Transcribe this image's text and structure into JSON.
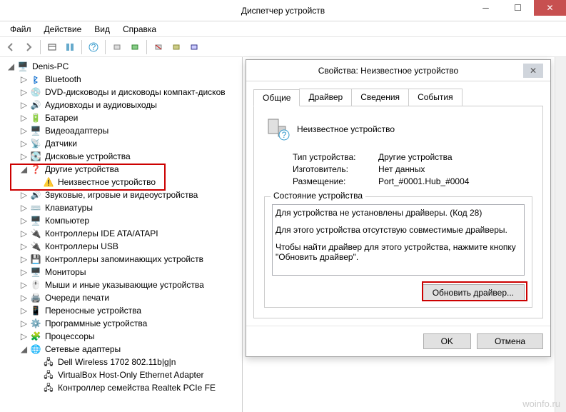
{
  "window": {
    "title": "Диспетчер устройств"
  },
  "menu": {
    "file": "Файл",
    "action": "Действие",
    "view": "Вид",
    "help": "Справка"
  },
  "tree": {
    "root": "Denis-PC",
    "bluetooth": "Bluetooth",
    "dvd": "DVD-дисководы и дисководы компакт-дисков",
    "audio": "Аудиовходы и аудиовыходы",
    "battery": "Батареи",
    "video": "Видеоадаптеры",
    "sensors": "Датчики",
    "disk": "Дисковые устройства",
    "other": "Другие устройства",
    "unknown": "Неизвестное устройство",
    "sound": "Звуковые, игровые и видеоустройства",
    "keyboards": "Клавиатуры",
    "computer": "Компьютер",
    "ide": "Контроллеры IDE ATA/ATAPI",
    "usb": "Контроллеры USB",
    "storage": "Контроллеры запоминающих устройств",
    "monitors": "Мониторы",
    "mice": "Мыши и иные указывающие устройства",
    "print": "Очереди печати",
    "portable": "Переносные устройства",
    "software": "Программные устройства",
    "cpu": "Процессоры",
    "network": "Сетевые адаптеры",
    "dell": "Dell Wireless 1702 802.11b|g|n",
    "vbox": "VirtualBox Host-Only Ethernet Adapter",
    "realtek": "Контроллер семейства Realtek PCIe FE"
  },
  "dialog": {
    "title": "Свойства: Неизвестное устройство",
    "tabs": {
      "general": "Общие",
      "driver": "Драйвер",
      "details": "Сведения",
      "events": "События"
    },
    "device_name": "Неизвестное устройство",
    "prop_type_label": "Тип устройства:",
    "prop_type_value": "Другие устройства",
    "prop_mfg_label": "Изготовитель:",
    "prop_mfg_value": "Нет данных",
    "prop_loc_label": "Размещение:",
    "prop_loc_value": "Port_#0001.Hub_#0004",
    "status_group": "Состояние устройства",
    "status_line1": "Для устройства не установлены драйверы. (Код 28)",
    "status_line2": "Для этого устройства отсутствую совместимые драйверы.",
    "status_line3": "Чтобы найти драйвер для этого устройства, нажмите кнопку \"Обновить драйвер\".",
    "update_btn": "Обновить драйвер...",
    "ok": "OK",
    "cancel": "Отмена"
  },
  "watermark": "woinfo.ru"
}
